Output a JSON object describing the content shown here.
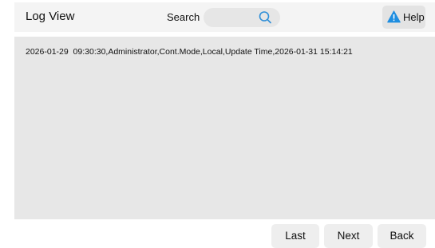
{
  "header": {
    "title": "Log View",
    "search_label": "Search",
    "search_value": "",
    "help_label": "Help"
  },
  "icons": {
    "search": "search-icon",
    "help": "warning-triangle-icon"
  },
  "colors": {
    "search_icon": "#2f8fd8",
    "help_icon": "#1f8ee0"
  },
  "log": {
    "entries": [
      "2026-01-29  09:30:30,Administrator,Cont.Mode,Local,Update Time,2026-01-31 15:14:21"
    ]
  },
  "footer": {
    "last_label": "Last",
    "next_label": "Next",
    "back_label": "Back"
  }
}
